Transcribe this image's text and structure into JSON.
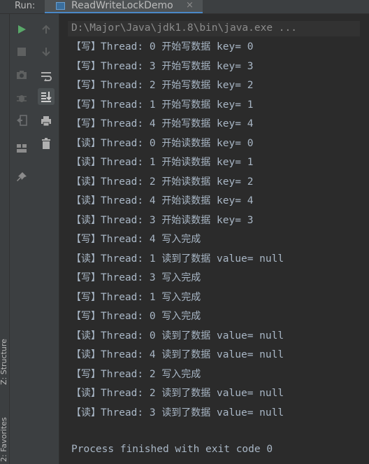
{
  "run_bar": {
    "label": "Run:",
    "tab_title": "ReadWriteLockDemo",
    "tab_close": "×"
  },
  "side_tabs": {
    "structure": "Z: Structure",
    "favorites": "2: Favorites"
  },
  "toolbar": {
    "icons": [
      "run-icon",
      "stop-icon",
      "camera-icon",
      "debug-icon",
      "exit-icon",
      "layout-icon",
      "pin-icon",
      "up-arrow-icon",
      "down-arrow-icon",
      "soft-wrap-icon",
      "scroll-to-end-icon",
      "print-icon",
      "trash-icon"
    ]
  },
  "console": {
    "command": "D:\\Major\\Java\\jdk1.8\\bin\\java.exe ...",
    "lines": [
      {
        "tag": "【写】",
        "thread": "Thread: 0",
        "msg": "开始写数据",
        "tail": " key= 0"
      },
      {
        "tag": "【写】",
        "thread": "Thread: 3",
        "msg": "开始写数据",
        "tail": " key= 3"
      },
      {
        "tag": "【写】",
        "thread": "Thread: 2",
        "msg": "开始写数据",
        "tail": " key= 2"
      },
      {
        "tag": "【写】",
        "thread": "Thread: 1",
        "msg": "开始写数据",
        "tail": " key= 1"
      },
      {
        "tag": "【写】",
        "thread": "Thread: 4",
        "msg": "开始写数据",
        "tail": " key= 4"
      },
      {
        "tag": "【读】",
        "thread": "Thread: 0",
        "msg": "开始读数据",
        "tail": " key= 0"
      },
      {
        "tag": "【读】",
        "thread": "Thread: 1",
        "msg": "开始读数据",
        "tail": " key= 1"
      },
      {
        "tag": "【读】",
        "thread": "Thread: 2",
        "msg": "开始读数据",
        "tail": " key= 2"
      },
      {
        "tag": "【读】",
        "thread": "Thread: 4",
        "msg": "开始读数据",
        "tail": " key= 4"
      },
      {
        "tag": "【读】",
        "thread": "Thread: 3",
        "msg": "开始读数据",
        "tail": " key= 3"
      },
      {
        "tag": "【写】",
        "thread": "Thread: 4",
        "msg": "写入完成",
        "tail": ""
      },
      {
        "tag": "【读】",
        "thread": "Thread: 1",
        "msg": "读到了数据",
        "tail": " value= null"
      },
      {
        "tag": "【写】",
        "thread": "Thread: 3",
        "msg": "写入完成",
        "tail": ""
      },
      {
        "tag": "【写】",
        "thread": "Thread: 1",
        "msg": "写入完成",
        "tail": ""
      },
      {
        "tag": "【写】",
        "thread": "Thread: 0",
        "msg": "写入完成",
        "tail": ""
      },
      {
        "tag": "【读】",
        "thread": "Thread: 0",
        "msg": "读到了数据",
        "tail": " value= null"
      },
      {
        "tag": "【读】",
        "thread": "Thread: 4",
        "msg": "读到了数据",
        "tail": " value= null"
      },
      {
        "tag": "【写】",
        "thread": "Thread: 2",
        "msg": "写入完成",
        "tail": ""
      },
      {
        "tag": "【读】",
        "thread": "Thread: 2",
        "msg": "读到了数据",
        "tail": " value= null"
      },
      {
        "tag": "【读】",
        "thread": "Thread: 3",
        "msg": "读到了数据",
        "tail": " value= null"
      }
    ],
    "exit_message": "Process finished with exit code 0"
  },
  "colors": {
    "background": "#2b2b2b",
    "panel": "#3c3f41",
    "text": "#a9b7c6",
    "run_green": "#59a869",
    "accent_blue": "#4a88c7"
  }
}
